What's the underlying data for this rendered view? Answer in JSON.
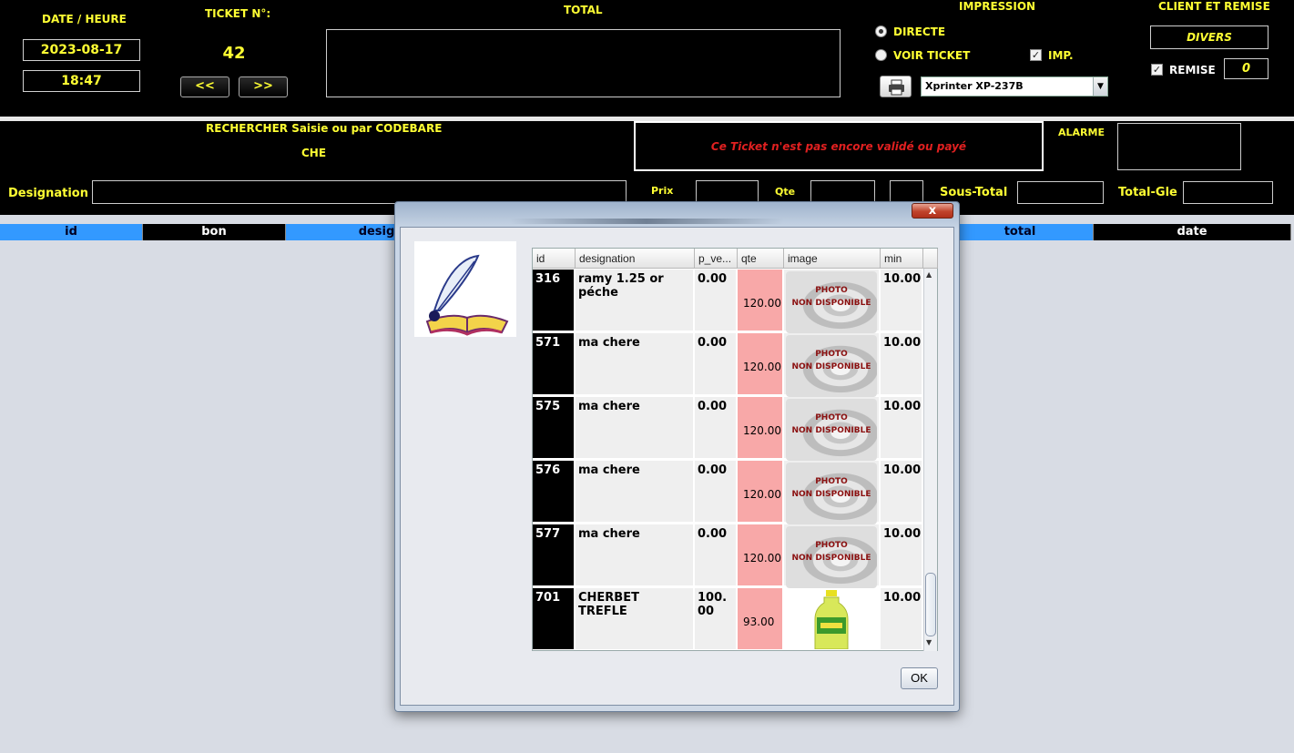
{
  "header": {
    "date_heure_label": "DATE / HEURE",
    "date": "2023-08-17",
    "heure": "18:47",
    "ticket_label": "TICKET N°:",
    "ticket_number": "42",
    "prev_label": "<<",
    "next_label": ">>",
    "total_label": "TOTAL",
    "total_value": "",
    "impression_label": "IMPRESSION",
    "directe_label": "DIRECTE",
    "voir_ticket_label": "VOIR TICKET",
    "imp_label": "IMP.",
    "printer_value": "Xprinter XP-237B",
    "client_label": "CLIENT ET REMISE",
    "client_value": "DIVERS",
    "remise_label": "REMISE",
    "remise_value": "0"
  },
  "search": {
    "title": "RECHERCHER Saisie ou par CODEBARE",
    "query": "CHE",
    "status_message": "Ce Ticket n'est pas encore validé ou payé",
    "alarme_label": "ALARME",
    "designation_label": "Designation",
    "prix_label": "Prix",
    "qte_label": "Qte",
    "sous_total_label": "Sous-Total",
    "total_gle_label": "Total-Gle"
  },
  "main_table": {
    "columns": [
      "id",
      "bon",
      "desig",
      "total",
      "date"
    ]
  },
  "dialog": {
    "close_label": "x",
    "ok_label": "OK",
    "columns": [
      "id",
      "designation",
      "p_ve...",
      "qte",
      "image",
      "min"
    ],
    "rows": [
      {
        "id": "316",
        "designation": "ramy 1.25 or péche",
        "p_vente": "0.00",
        "qte": "120.00",
        "image": "PHOTO NON DISPONIBLE",
        "min": "10.00"
      },
      {
        "id": "571",
        "designation": "ma chere",
        "p_vente": "0.00",
        "qte": "120.00",
        "image": "PHOTO NON DISPONIBLE",
        "min": "10.00"
      },
      {
        "id": "575",
        "designation": "ma chere",
        "p_vente": "0.00",
        "qte": "120.00",
        "image": "PHOTO NON DISPONIBLE",
        "min": "10.00"
      },
      {
        "id": "576",
        "designation": "ma chere",
        "p_vente": "0.00",
        "qte": "120.00",
        "image": "PHOTO NON DISPONIBLE",
        "min": "10.00"
      },
      {
        "id": "577",
        "designation": "ma chere",
        "p_vente": "0.00",
        "qte": "120.00",
        "image": "PHOTO NON DISPONIBLE",
        "min": "10.00"
      },
      {
        "id": "701",
        "designation": "CHERBET  TREFLE",
        "p_vente": "100.00",
        "qte": "93.00",
        "image": "bottle",
        "min": "10.00"
      }
    ],
    "photo_line1": "PHOTO",
    "photo_line2": "NON DISPONIBLE"
  },
  "colors": {
    "yellow_text": "#ffff33",
    "header_blue": "#3399ff",
    "qte_pink": "#f8a8a8",
    "alert_red": "#e02020"
  }
}
